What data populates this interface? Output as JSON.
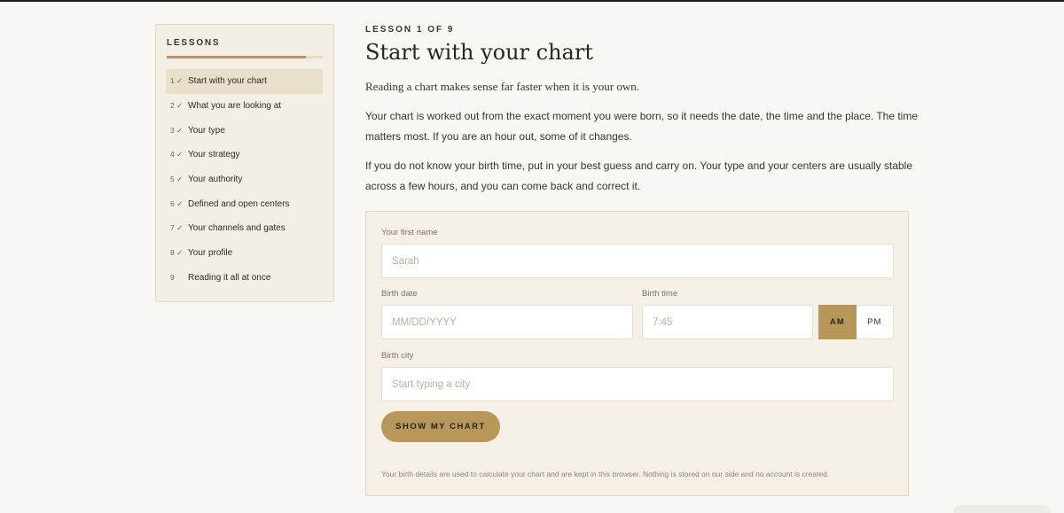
{
  "sidebar": {
    "title": "LESSONS",
    "progress": 0.89,
    "items": [
      {
        "num": "1 ✓",
        "label": "Start with your chart",
        "active": true
      },
      {
        "num": "2 ✓",
        "label": "What you are looking at"
      },
      {
        "num": "3 ✓",
        "label": "Your type"
      },
      {
        "num": "4 ✓",
        "label": "Your strategy"
      },
      {
        "num": "5 ✓",
        "label": "Your authority"
      },
      {
        "num": "6 ✓",
        "label": "Defined and open centers"
      },
      {
        "num": "7 ✓",
        "label": "Your channels and gates"
      },
      {
        "num": "8 ✓",
        "label": "Your profile"
      },
      {
        "num": "9",
        "label": "Reading it all at once"
      }
    ]
  },
  "main": {
    "kicker": "LESSON 1 OF 9",
    "title": "Start with your chart",
    "lead": "Reading a chart makes sense far faster when it is your own.",
    "paragraphs": [
      "Your chart is worked out from the exact moment you were born, so it needs the date, the time and the place. The time matters most. If you are an hour out, some of it changes.",
      "If you do not know your birth time, put in your best guess and carry on. Your type and your centers are usually stable across a few hours, and you can come back and correct it."
    ]
  },
  "form": {
    "first_name_label": "Your first name",
    "first_name_placeholder": "Sarah",
    "birth_date_label": "Birth date",
    "birth_date_placeholder": "MM/DD/YYYY",
    "birth_time_label": "Birth time",
    "birth_time_placeholder": "7:45",
    "am_label": "AM",
    "pm_label": "PM",
    "birth_city_label": "Birth city",
    "birth_city_placeholder": "Start typing a city",
    "submit_label": "SHOW MY CHART",
    "fineprint": "Your birth details are used to calculate your chart and are kept in this browser. Nothing is stored on our side and no account is created."
  },
  "colors": {
    "accent": "#b8975a",
    "background": "#f8f7f3",
    "card": "#f4f0e6"
  }
}
